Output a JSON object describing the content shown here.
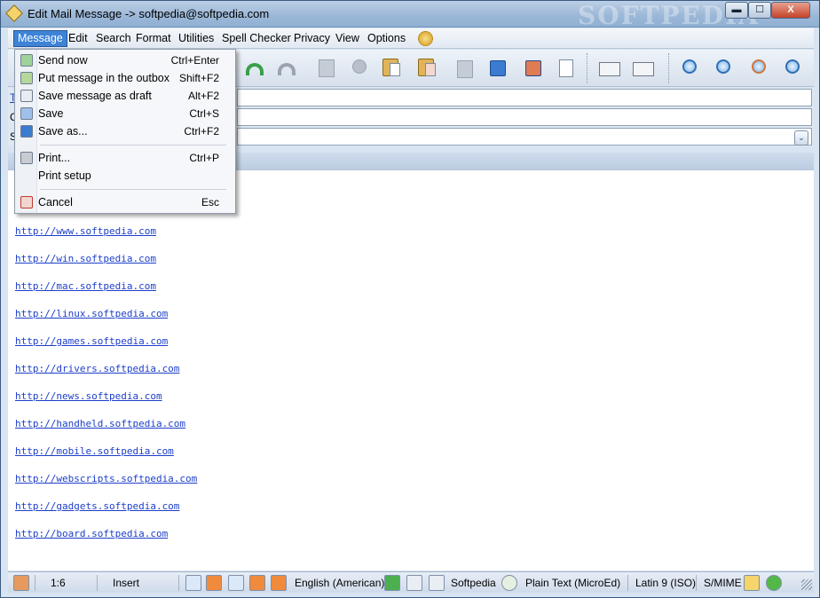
{
  "window": {
    "title": "Edit Mail Message -> softpedia@softpedia.com",
    "watermark": "SOFTPEDIA",
    "min_glyph": "▬",
    "max_glyph": "☐",
    "close_glyph": "X"
  },
  "menubar": {
    "items": [
      "Message",
      "Edit",
      "Search",
      "Format",
      "Utilities",
      "Spell Checker",
      "Privacy",
      "View",
      "Options"
    ]
  },
  "toolbar": {
    "icons": [
      "new-message-icon",
      "reply-icon",
      "undo-icon",
      "redo-icon",
      "copy-disabled-icon",
      "cut-icon",
      "paste-icon",
      "paste-special-icon",
      "save-disabled-icon",
      "save-icon",
      "save-as-icon",
      "attach-icon",
      "check-mail-icon",
      "send-receive-icon",
      "address-back-icon",
      "address-search-icon",
      "address-down-icon",
      "address-forward-icon"
    ]
  },
  "fields": {
    "to_stub": "T",
    "cc_stub": "C",
    "subject_stub": "S",
    "dropdown_glyph": "⌄"
  },
  "message_menu": {
    "items": [
      {
        "label": "Send now",
        "shortcut": "Ctrl+Enter",
        "icon": "send-now-icon"
      },
      {
        "label": "Put message in the outbox",
        "shortcut": "Shift+F2",
        "icon": "outbox-icon"
      },
      {
        "label": "Save message as draft",
        "shortcut": "Alt+F2",
        "icon": "draft-icon"
      },
      {
        "label": "Save",
        "shortcut": "Ctrl+S",
        "icon": "save-icon"
      },
      {
        "label": "Save as...",
        "shortcut": "Ctrl+F2",
        "icon": "save-as-icon"
      },
      {
        "label": "Print...",
        "shortcut": "Ctrl+P",
        "icon": "printer-icon"
      },
      {
        "label": "Print setup",
        "shortcut": "",
        "icon": ""
      },
      {
        "label": "Cancel",
        "shortcut": "Esc",
        "icon": "cancel-icon"
      }
    ]
  },
  "body_links": [
    "http://www.softpedia.com",
    "http://win.softpedia.com",
    "http://mac.softpedia.com",
    "http://linux.softpedia.com",
    "http://games.softpedia.com",
    "http://drivers.softpedia.com",
    "http://news.softpedia.com",
    "http://handheld.softpedia.com",
    "http://mobile.softpedia.com",
    "http://webscripts.softpedia.com",
    "http://gadgets.softpedia.com",
    "http://board.softpedia.com"
  ],
  "statusbar": {
    "position": "1:6",
    "mode": "Insert",
    "language": "English (American)",
    "signature": "Softpedia",
    "format": "Plain Text (MicroEd)",
    "charset": "Latin 9 (ISO)",
    "security": "S/MIME"
  },
  "colors": {
    "accent": "#3e83d6",
    "link": "#1d3fc9",
    "window_frame": "#9db8d8"
  }
}
